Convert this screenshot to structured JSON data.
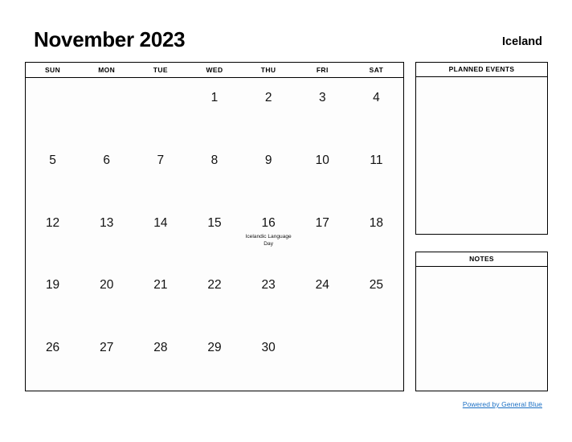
{
  "header": {
    "month_title": "November 2023",
    "locale_title": "Iceland"
  },
  "calendar": {
    "day_headers": [
      "SUN",
      "MON",
      "TUE",
      "WED",
      "THU",
      "FRI",
      "SAT"
    ],
    "weeks": [
      [
        {
          "day": "",
          "event": ""
        },
        {
          "day": "",
          "event": ""
        },
        {
          "day": "",
          "event": ""
        },
        {
          "day": "1",
          "event": ""
        },
        {
          "day": "2",
          "event": ""
        },
        {
          "day": "3",
          "event": ""
        },
        {
          "day": "4",
          "event": ""
        }
      ],
      [
        {
          "day": "5",
          "event": ""
        },
        {
          "day": "6",
          "event": ""
        },
        {
          "day": "7",
          "event": ""
        },
        {
          "day": "8",
          "event": ""
        },
        {
          "day": "9",
          "event": ""
        },
        {
          "day": "10",
          "event": ""
        },
        {
          "day": "11",
          "event": ""
        }
      ],
      [
        {
          "day": "12",
          "event": ""
        },
        {
          "day": "13",
          "event": ""
        },
        {
          "day": "14",
          "event": ""
        },
        {
          "day": "15",
          "event": ""
        },
        {
          "day": "16",
          "event": "Icelandic Language Day"
        },
        {
          "day": "17",
          "event": ""
        },
        {
          "day": "18",
          "event": ""
        }
      ],
      [
        {
          "day": "19",
          "event": ""
        },
        {
          "day": "20",
          "event": ""
        },
        {
          "day": "21",
          "event": ""
        },
        {
          "day": "22",
          "event": ""
        },
        {
          "day": "23",
          "event": ""
        },
        {
          "day": "24",
          "event": ""
        },
        {
          "day": "25",
          "event": ""
        }
      ],
      [
        {
          "day": "26",
          "event": ""
        },
        {
          "day": "27",
          "event": ""
        },
        {
          "day": "28",
          "event": ""
        },
        {
          "day": "29",
          "event": ""
        },
        {
          "day": "30",
          "event": ""
        },
        {
          "day": "",
          "event": ""
        },
        {
          "day": "",
          "event": ""
        }
      ]
    ]
  },
  "planned_events": {
    "title": "PLANNED EVENTS",
    "content": ""
  },
  "notes": {
    "title": "NOTES",
    "content": ""
  },
  "footer": {
    "link_label": "Powered by General Blue",
    "link_color": "#1a6fc4"
  }
}
